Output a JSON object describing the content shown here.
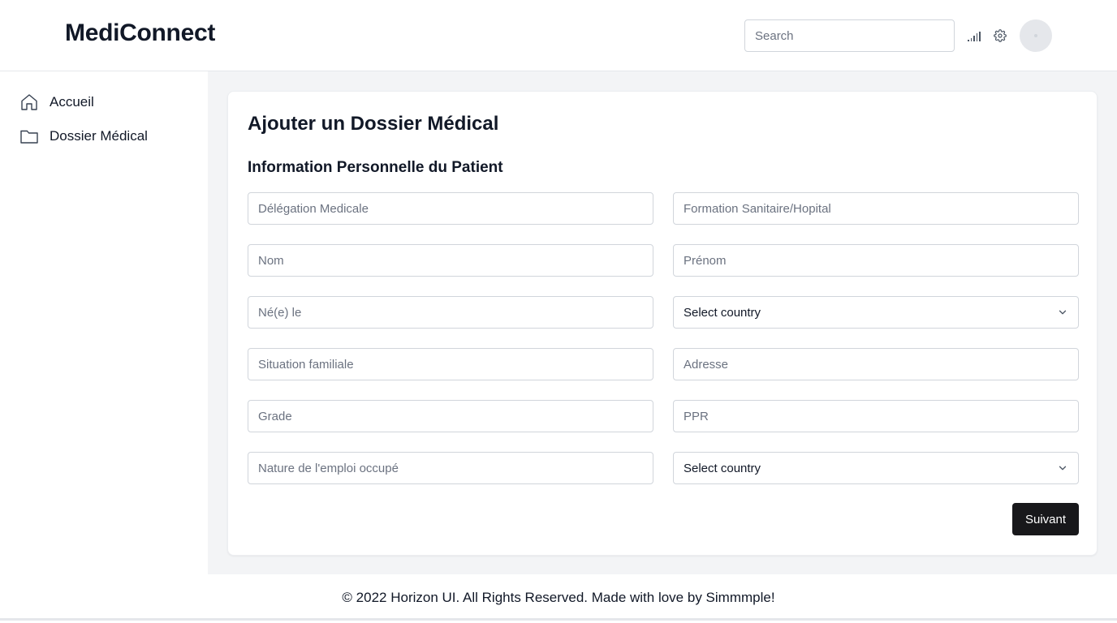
{
  "header": {
    "brand": "MediConnect",
    "search_placeholder": "Search"
  },
  "sidebar": {
    "items": [
      {
        "label": "Accueil",
        "icon": "home-icon"
      },
      {
        "label": "Dossier Médical",
        "icon": "folder-icon"
      }
    ]
  },
  "main": {
    "title": "Ajouter un Dossier Médical",
    "section_title": "Information Personnelle du Patient",
    "fields": {
      "delegation": {
        "placeholder": "Délégation Medicale",
        "value": ""
      },
      "formation": {
        "placeholder": "Formation Sanitaire/Hopital",
        "value": ""
      },
      "nom": {
        "placeholder": "Nom",
        "value": ""
      },
      "prenom": {
        "placeholder": "Prénom",
        "value": ""
      },
      "ne_le": {
        "placeholder": "Né(e) le",
        "value": ""
      },
      "country_1": {
        "selected": "Select country"
      },
      "situation": {
        "placeholder": "Situation familiale",
        "value": ""
      },
      "adresse": {
        "placeholder": "Adresse",
        "value": ""
      },
      "grade": {
        "placeholder": "Grade",
        "value": ""
      },
      "ppr": {
        "placeholder": "PPR",
        "value": ""
      },
      "nature_emploi": {
        "placeholder": "Nature de l'emploi occupé",
        "value": ""
      },
      "country_2": {
        "selected": "Select country"
      }
    },
    "next_label": "Suivant"
  },
  "footer": {
    "text": "© 2022 Horizon UI. All Rights Reserved. Made with love by Simmmple!"
  },
  "colors": {
    "primary_button": "#18181b",
    "main_background": "#f3f4f6",
    "border": "#d1d5db"
  }
}
